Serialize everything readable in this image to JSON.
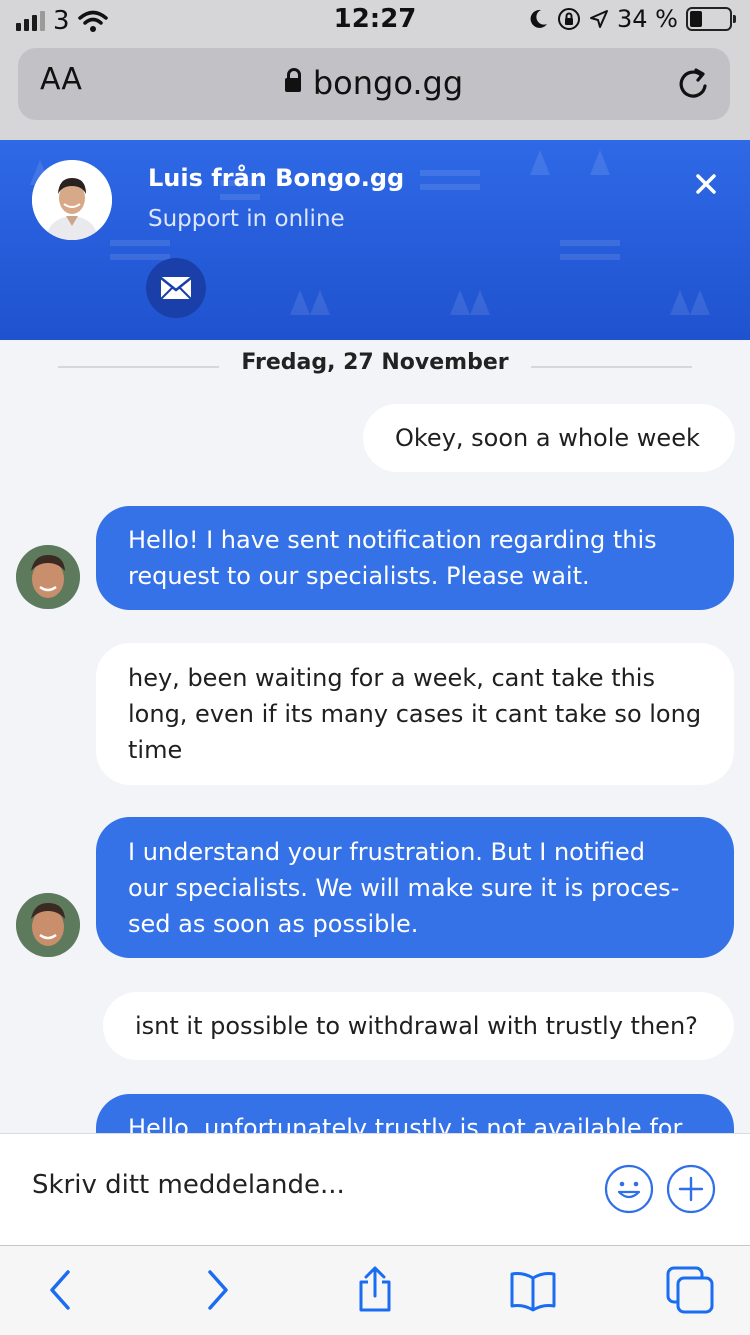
{
  "status_bar": {
    "carrier": "3",
    "time": "12:27",
    "battery_percent": "34 %"
  },
  "browser": {
    "text_size_label": "AA",
    "url": "bongo.gg"
  },
  "chat_header": {
    "agent_name": "Luis från Bongo.gg",
    "status": "Support in online"
  },
  "date_separator": "Fredag, 27 November",
  "messages": [
    {
      "from": "user",
      "text": "Okey, soon a whole week"
    },
    {
      "from": "agent",
      "lines": [
        "Hello! I have sent notification regarding this",
        "request to our specialists. Please wait."
      ]
    },
    {
      "from": "user",
      "lines": [
        "hey, been waiting for a week, cant take this",
        "long, even if its many cases it cant take so long",
        "time"
      ]
    },
    {
      "from": "agent",
      "lines": [
        "I understand your frustration. But I notified",
        "our specialists. We will make sure it is proces-",
        "sed as soon as possible."
      ]
    },
    {
      "from": "user",
      "text": "isnt it possible to withdrawal with trustly then?"
    },
    {
      "from": "agent",
      "text": "Hello, unfortunately trustly is not available for"
    }
  ],
  "composer": {
    "placeholder": "Skriv ditt meddelande..."
  },
  "colors": {
    "header_blue": "#2a5fe0",
    "agent_bubble": "#3572e8",
    "ios_blue": "#1a6cf0"
  },
  "icons": [
    "signal-icon",
    "wifi-icon",
    "moon-icon",
    "orientation-lock-icon",
    "location-icon",
    "battery-icon",
    "lock-icon",
    "reload-icon",
    "mail-icon",
    "close-icon",
    "emoji-icon",
    "plus-icon",
    "back-icon",
    "forward-icon",
    "share-icon",
    "bookmarks-icon",
    "tabs-icon"
  ]
}
